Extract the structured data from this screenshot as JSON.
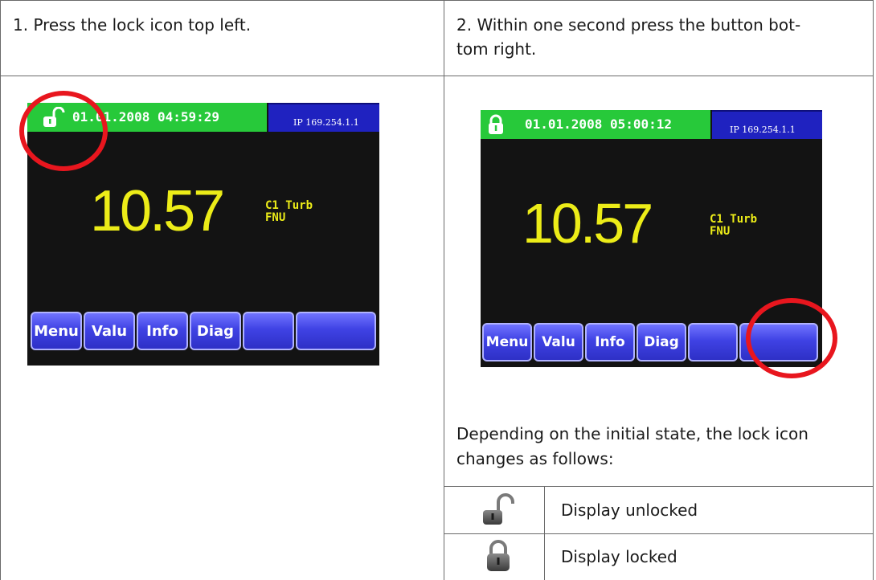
{
  "steps": {
    "step1": "1. Press the lock icon top left.",
    "step2_line1": "2. Within one second press the button bot-",
    "step2_line2": "tom right."
  },
  "screen_left": {
    "datetime": "01.01.2008 04:59:29",
    "ip": "IP 169.254.1.1",
    "value": "10.57",
    "channel": "C1 Turb",
    "unit": "FNU",
    "lock_state": "unlocked",
    "buttons": [
      "Menu",
      "Valu",
      "Info",
      "Diag",
      "",
      ""
    ]
  },
  "screen_right": {
    "datetime": "01.01.2008 05:00:12",
    "ip": "IP 169.254.1.1",
    "value": "10.57",
    "channel": "C1 Turb",
    "unit": "FNU",
    "lock_state": "locked",
    "buttons": [
      "Menu",
      "Valu",
      "Info",
      "Diag",
      "",
      ""
    ]
  },
  "description": {
    "line1": "Depending on the initial state, the lock icon",
    "line2": "changes as follows:"
  },
  "legend": [
    {
      "icon": "lock-open-icon",
      "label": "Display unlocked"
    },
    {
      "icon": "lock-closed-icon",
      "label": "Display locked"
    }
  ],
  "colors": {
    "statusbar": "#27c93a",
    "ipbar": "#1f22c0",
    "value": "#ecec18",
    "highlight_ring": "#e8161e",
    "button": "#3f42e4"
  }
}
